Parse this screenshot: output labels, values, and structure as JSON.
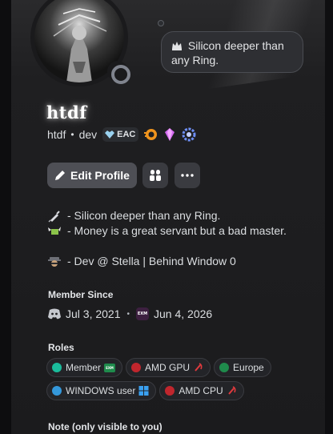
{
  "profile": {
    "display_name": "htdf",
    "username": "htdf",
    "pronoun_tag": "dev",
    "server_tag": "EAC",
    "status_bubble": "Silicon deeper than any Ring."
  },
  "actions": {
    "edit_label": "Edit Profile"
  },
  "bio": {
    "line1": "- Silicon deeper than any Ring.",
    "line2": "- Money is a great servant but a bad master.",
    "line3": "- Dev @ Stella | Behind Window 0"
  },
  "member_since": {
    "title": "Member Since",
    "discord_date": "Jul 3, 2021",
    "server_date": "Jun 4, 2026",
    "server_icon_text": "EXM"
  },
  "roles": {
    "title": "Roles",
    "items": [
      {
        "label": "Member",
        "color": "#1abc9c"
      },
      {
        "label": "AMD GPU",
        "color": "#c0262d"
      },
      {
        "label": "Europe",
        "color": "#1f8b4c"
      },
      {
        "label": "WINDOWS user",
        "color": "#3498db"
      },
      {
        "label": "AMD CPU",
        "color": "#c0262d"
      }
    ]
  },
  "note": {
    "title": "Note (only visible to you)"
  },
  "colors": {
    "background": "#1a1a1d",
    "button": "#4e4f55",
    "name_glow": "#ffffff"
  }
}
